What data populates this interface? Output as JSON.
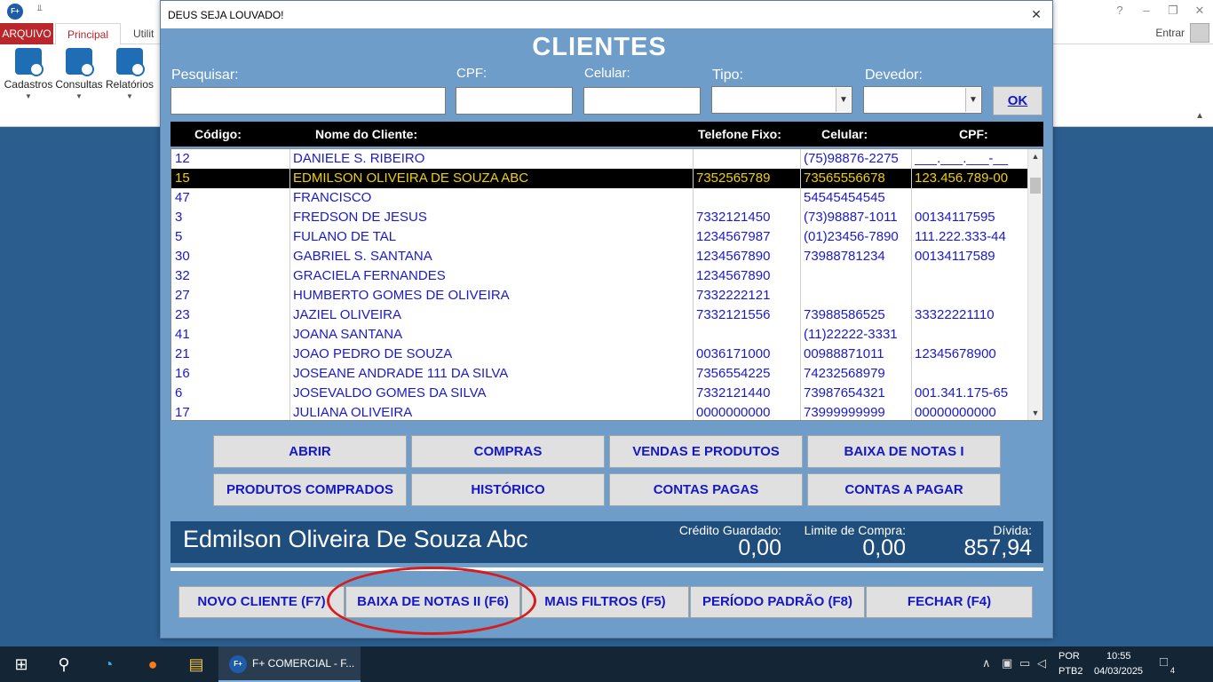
{
  "background": {
    "app_logo": "F+",
    "tabs": {
      "arquivo": "ARQUIVO",
      "principal": "Principal",
      "utilit": "Utilit"
    },
    "entrar": "Entrar",
    "ribbon": [
      {
        "label": "Cadastros",
        "icon": "document-add-icon"
      },
      {
        "label": "Consultas",
        "icon": "document-search-icon"
      },
      {
        "label": "Relatórios",
        "icon": "report-icon"
      }
    ]
  },
  "dialog": {
    "title": "DEUS SEJA LOUVADO!",
    "heading": "CLIENTES",
    "filters": {
      "pesquisar_label": "Pesquisar:",
      "cpf_label": "CPF:",
      "celular_label": "Celular:",
      "tipo_label": "Tipo:",
      "devedor_label": "Devedor:",
      "ok_label": "OK"
    },
    "columns": {
      "codigo": "Código:",
      "nome": "Nome do Cliente:",
      "fixo": "Telefone Fixo:",
      "celular": "Celular:",
      "cpf": "CPF:"
    },
    "rows": [
      {
        "code": "12",
        "name": "DANIELE S. RIBEIRO",
        "fixo": "",
        "cel": "(75)98876-2275",
        "cpf": "___.___.___-__"
      },
      {
        "code": "15",
        "name": "EDMILSON OLIVEIRA DE SOUZA ABC",
        "fixo": "7352565789",
        "cel": "73565556678",
        "cpf": "123.456.789-00"
      },
      {
        "code": "47",
        "name": "FRANCISCO",
        "fixo": "",
        "cel": "54545454545",
        "cpf": ""
      },
      {
        "code": "3",
        "name": "FREDSON DE JESUS",
        "fixo": "7332121450",
        "cel": "(73)98887-1011",
        "cpf": "00134117595"
      },
      {
        "code": "5",
        "name": "FULANO DE TAL",
        "fixo": "1234567987",
        "cel": "(01)23456-7890",
        "cpf": "111.222.333-44"
      },
      {
        "code": "30",
        "name": "GABRIEL S. SANTANA",
        "fixo": "1234567890",
        "cel": "73988781234",
        "cpf": "00134117589"
      },
      {
        "code": "32",
        "name": "GRACIELA FERNANDES",
        "fixo": "1234567890",
        "cel": "",
        "cpf": ""
      },
      {
        "code": "27",
        "name": "HUMBERTO GOMES DE OLIVEIRA",
        "fixo": "7332222121",
        "cel": "",
        "cpf": ""
      },
      {
        "code": "23",
        "name": "JAZIEL OLIVEIRA",
        "fixo": "7332121556",
        "cel": "73988586525",
        "cpf": "33322221110"
      },
      {
        "code": "41",
        "name": "JOANA SANTANA",
        "fixo": "",
        "cel": "(11)22222-3331",
        "cpf": ""
      },
      {
        "code": "21",
        "name": "JOAO PEDRO DE SOUZA",
        "fixo": "0036171000",
        "cel": "00988871011",
        "cpf": "12345678900"
      },
      {
        "code": "16",
        "name": "JOSEANE ANDRADE 111 DA SILVA",
        "fixo": "7356554225",
        "cel": "74232568979",
        "cpf": ""
      },
      {
        "code": "6",
        "name": "JOSEVALDO GOMES DA SILVA",
        "fixo": "7332121440",
        "cel": "73987654321",
        "cpf": "001.341.175-65"
      },
      {
        "code": "17",
        "name": "JULIANA OLIVEIRA",
        "fixo": "0000000000",
        "cel": "73999999999",
        "cpf": "00000000000"
      }
    ],
    "selected_row": 1,
    "actions": [
      "ABRIR",
      "COMPRAS",
      "VENDAS E PRODUTOS",
      "BAIXA DE NOTAS I",
      "PRODUTOS COMPRADOS",
      "HISTÓRICO",
      "CONTAS PAGAS",
      "CONTAS A PAGAR"
    ],
    "summary": {
      "name": "Edmilson Oliveira De Souza Abc",
      "credito_label": "Crédito Guardado:",
      "credito_value": "0,00",
      "limite_label": "Limite de Compra:",
      "limite_value": "0,00",
      "divida_label": "Dívida:",
      "divida_value": "857,94"
    },
    "bottom_buttons": [
      "NOVO CLIENTE  (F7)",
      "BAIXA DE NOTAS II  (F6)",
      "MAIS FILTROS (F5)",
      "PERÍODO PADRÃO (F8)",
      "FECHAR (F4)"
    ],
    "highlight_color": "#d81c1c"
  },
  "taskbar": {
    "task_label": "F+ COMERCIAL - F...",
    "task_icon": "F+",
    "lang_top": "POR",
    "lang_bottom": "PTB2",
    "time": "10:55",
    "date": "04/03/2025",
    "notification_count": "4"
  }
}
